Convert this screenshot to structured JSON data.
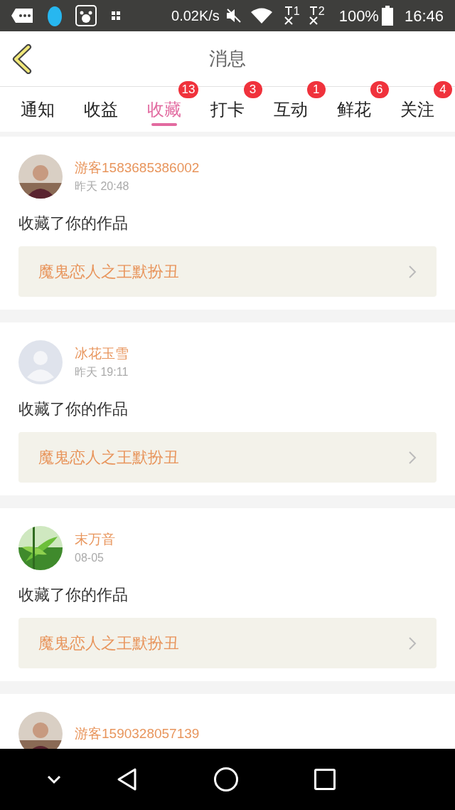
{
  "status_bar": {
    "speed": "0.02K/s",
    "sim_1": "1",
    "sim_2": "2",
    "battery": "100%",
    "time": "16:46"
  },
  "header": {
    "title": "消息"
  },
  "tabs": [
    {
      "label": "通知",
      "selected": false
    },
    {
      "label": "收益",
      "selected": false
    },
    {
      "label": "收藏",
      "selected": true,
      "badge": "13"
    },
    {
      "label": "打卡",
      "selected": false,
      "badge": "3"
    },
    {
      "label": "互动",
      "selected": false,
      "badge": "1"
    },
    {
      "label": "鲜花",
      "selected": false,
      "badge": "6"
    },
    {
      "label": "关注",
      "selected": false,
      "badge": "4"
    }
  ],
  "messages": [
    {
      "user": "游客1583685386002",
      "time": "昨天 20:48",
      "action": "收藏了你的作品",
      "work": "魔鬼恋人之王默扮丑"
    },
    {
      "avatar": {
        "kind": "default"
      },
      "user": "冰花玉雪",
      "time": "昨天 19:11",
      "action": "收藏了你的作品",
      "work": "魔鬼恋人之王默扮丑"
    },
    {
      "avatar": {
        "kind": "plant"
      },
      "user": "末万音",
      "time": "08-05",
      "action": "收藏了你的作品",
      "work": "魔鬼恋人之王默扮丑"
    },
    {
      "user": "游客1590328057139"
    }
  ]
}
